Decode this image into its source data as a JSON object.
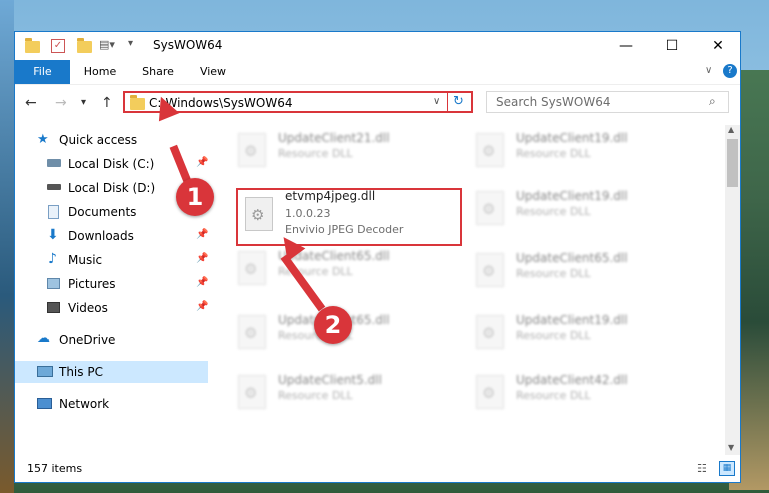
{
  "window": {
    "title": "SysWOW64"
  },
  "ribbon": {
    "tabs": [
      "File",
      "Home",
      "Share",
      "View"
    ]
  },
  "address": {
    "path": "C:\\Windows\\SysWOW64"
  },
  "search": {
    "placeholder": "Search SysWOW64"
  },
  "sidebar": {
    "items": [
      {
        "label": "Quick access"
      },
      {
        "label": "Local Disk (C:)"
      },
      {
        "label": "Local Disk (D:)"
      },
      {
        "label": "Documents"
      },
      {
        "label": "Downloads"
      },
      {
        "label": "Music"
      },
      {
        "label": "Pictures"
      },
      {
        "label": "Videos"
      },
      {
        "label": "OneDrive"
      },
      {
        "label": "This PC"
      },
      {
        "label": "Network"
      }
    ]
  },
  "files": {
    "highlighted": {
      "name": "etvmp4jpeg.dll",
      "version": "1.0.0.23",
      "description": "Envivio JPEG Decoder"
    },
    "left": [
      {
        "name": "UpdateClient21.dll",
        "type": "Resource DLL"
      },
      {
        "name": "UpdateClient65.dll",
        "type": "Resource DLL"
      },
      {
        "name": "UpdateClient65.dll",
        "type": "Resource DLL"
      },
      {
        "name": "UpdateClient5.dll",
        "type": "Resource DLL"
      }
    ],
    "right": [
      {
        "name": "UpdateClient19.dll",
        "type": "Resource DLL"
      },
      {
        "name": "UpdateClient19.dll",
        "type": "Resource DLL"
      },
      {
        "name": "UpdateClient65.dll",
        "type": "Resource DLL"
      },
      {
        "name": "UpdateClient19.dll",
        "type": "Resource DLL"
      },
      {
        "name": "UpdateClient42.dll",
        "type": "Resource DLL"
      }
    ]
  },
  "status": {
    "count": "157 items"
  },
  "annotations": {
    "step1": "1",
    "step2": "2"
  },
  "colors": {
    "accent": "#1979ca",
    "highlight": "#d9353a",
    "selected": "#cce8ff"
  }
}
